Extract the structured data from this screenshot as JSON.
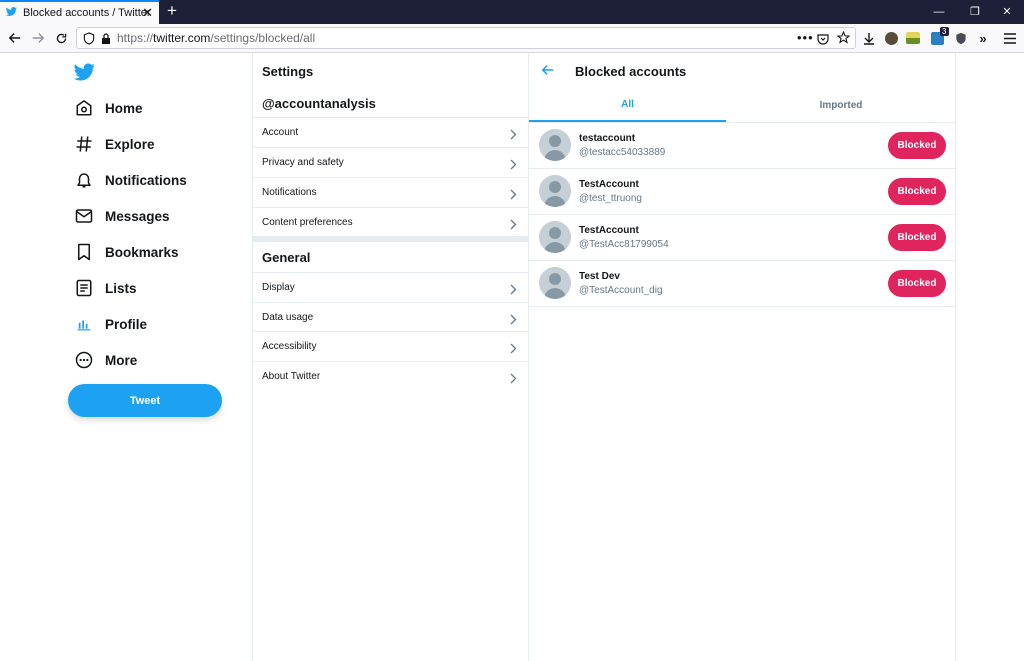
{
  "browser": {
    "tab_title": "Blocked accounts / Twitter",
    "url_prefix": "https://",
    "url_host": "twitter.com",
    "url_path": "/settings/blocked/all",
    "extension_badge": "3"
  },
  "nav": {
    "items": [
      {
        "label": "Home",
        "icon": "home-icon"
      },
      {
        "label": "Explore",
        "icon": "hashtag-icon"
      },
      {
        "label": "Notifications",
        "icon": "bell-icon"
      },
      {
        "label": "Messages",
        "icon": "envelope-icon"
      },
      {
        "label": "Bookmarks",
        "icon": "bookmark-icon"
      },
      {
        "label": "Lists",
        "icon": "list-icon"
      },
      {
        "label": "Profile",
        "icon": "profile-icon"
      },
      {
        "label": "More",
        "icon": "more-icon"
      }
    ],
    "tweet_label": "Tweet"
  },
  "settings": {
    "title": "Settings",
    "account_header": "@accountanalysis",
    "account_items": [
      "Account",
      "Privacy and safety",
      "Notifications",
      "Content preferences"
    ],
    "general_header": "General",
    "general_items": [
      "Display",
      "Data usage",
      "Accessibility",
      "About Twitter"
    ]
  },
  "blocked": {
    "title": "Blocked accounts",
    "tabs": [
      "All",
      "Imported"
    ],
    "button_label": "Blocked",
    "users": [
      {
        "name": "testaccount",
        "handle": "@testacc54033889"
      },
      {
        "name": "TestAccount",
        "handle": "@test_ttruong"
      },
      {
        "name": "TestAccount",
        "handle": "@TestAcc81799054"
      },
      {
        "name": "Test Dev",
        "handle": "@TestAccount_dig"
      }
    ]
  },
  "colors": {
    "accent": "#1da1f2",
    "blocked": "#e0245e",
    "tabbar": "#1d2038"
  }
}
